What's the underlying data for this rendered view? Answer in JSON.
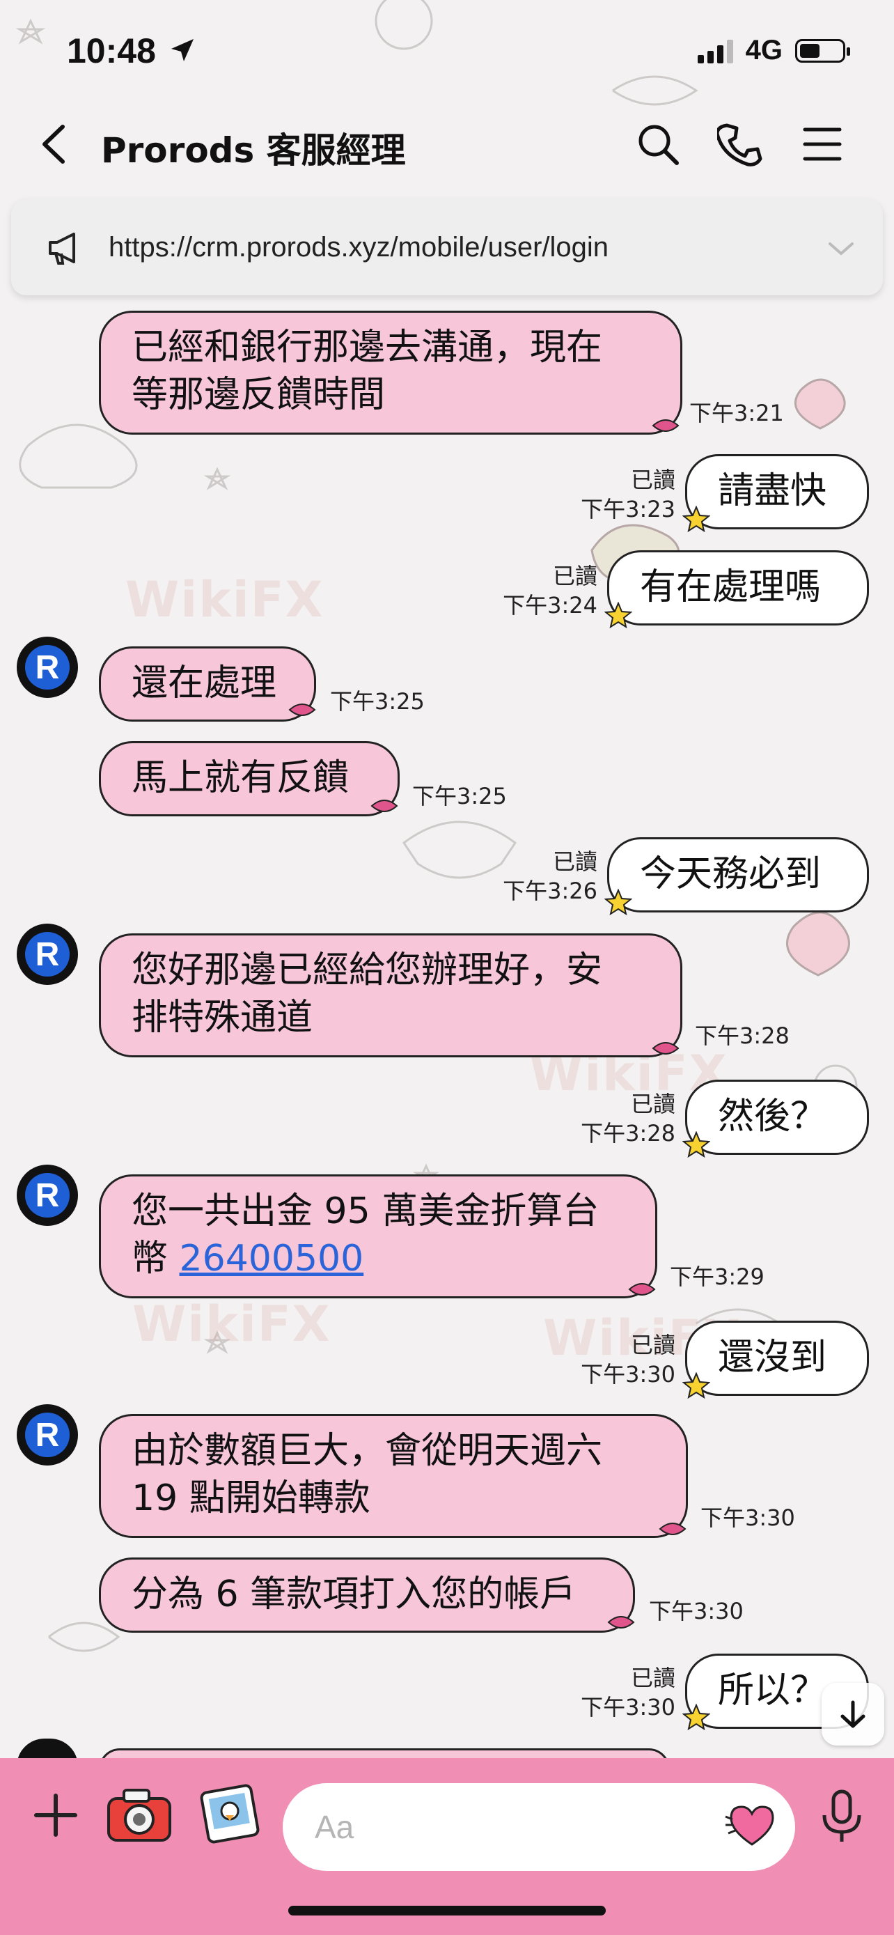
{
  "status_bar": {
    "time": "10:48",
    "network": "4G"
  },
  "header": {
    "title": "Prorods 客服經理"
  },
  "notice": {
    "text": "https://crm.prorods.xyz/mobile/user/login"
  },
  "watermark": "WikiFX",
  "messages": [
    {
      "side": "in",
      "line1": "已經和銀行那邊去溝通，現在",
      "line2": "等那邊反饋時間",
      "time": "下午3:21"
    },
    {
      "side": "out",
      "text": "請盡快",
      "read": "已讀",
      "time": "下午3:23"
    },
    {
      "side": "out",
      "text": "有在處理嗎",
      "read": "已讀",
      "time": "下午3:24"
    },
    {
      "side": "in",
      "text": "還在處理",
      "time": "下午3:25"
    },
    {
      "side": "in",
      "text": "馬上就有反饋",
      "time": "下午3:25"
    },
    {
      "side": "out",
      "text": "今天務必到",
      "read": "已讀",
      "time": "下午3:26"
    },
    {
      "side": "in",
      "line1": "您好那邊已經給您辦理好，安",
      "line2": "排特殊通道",
      "time": "下午3:28"
    },
    {
      "side": "out",
      "text": "然後？",
      "read": "已讀",
      "time": "下午3:28"
    },
    {
      "side": "in",
      "line1": "您一共出金 95 萬美金折算台",
      "line2_prefix": "幣 ",
      "link": "26400500",
      "time": "下午3:29"
    },
    {
      "side": "out",
      "text": "還沒到",
      "read": "已讀",
      "time": "下午3:30"
    },
    {
      "side": "in",
      "line1": "由於數額巨大，會從明天週六",
      "line2": "19 點開始轉款",
      "time": "下午3:30"
    },
    {
      "side": "in",
      "text": "分為 6 筆款項打入您的帳戶",
      "time": "下午3:30"
    },
    {
      "side": "out",
      "text": "所以？",
      "read": "已讀",
      "time": "下午3:30"
    }
  ],
  "composer": {
    "placeholder": "Aa"
  },
  "colors": {
    "incoming": "#f7c6d9",
    "outgoing": "#ffffff",
    "composer_bg": "#f08fb3",
    "link": "#2a64d8"
  },
  "icons": [
    "back-icon",
    "search-icon",
    "phone-icon",
    "menu-icon",
    "megaphone-icon",
    "chevron-down-icon",
    "plus-icon",
    "camera-icon",
    "photo-icon",
    "emoji-heart-icon",
    "mic-icon",
    "arrow-down-icon"
  ]
}
